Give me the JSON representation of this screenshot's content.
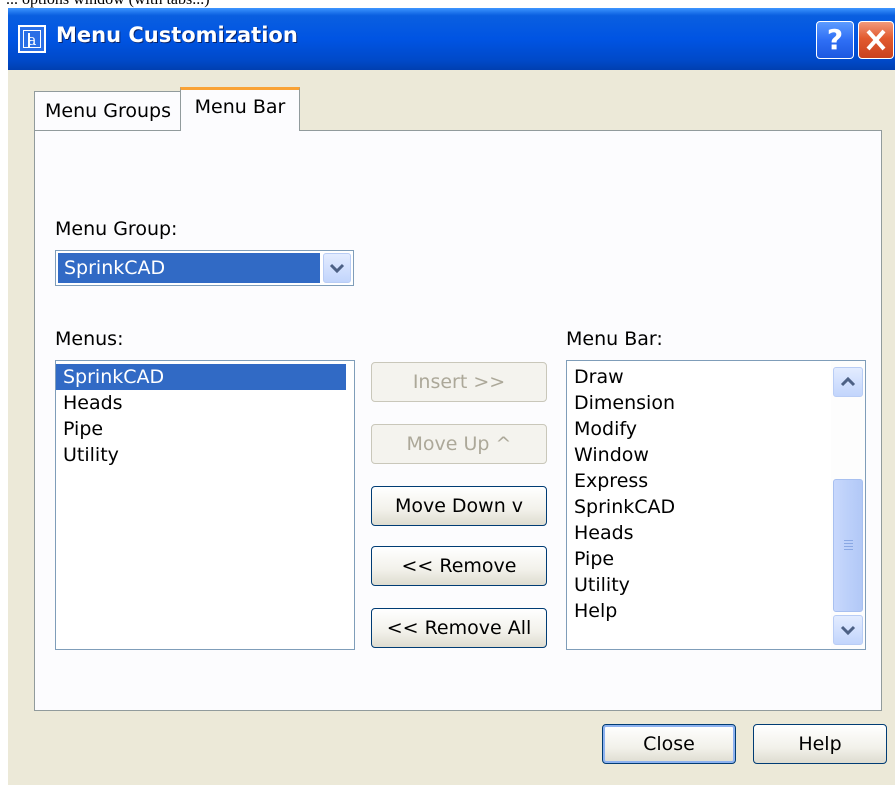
{
  "page_strip_text": "... options window (with tabs...)",
  "window": {
    "title": "Menu Customization",
    "help_glyph": "?",
    "close_glyph": "X",
    "icon": "app-icon"
  },
  "tabs": [
    {
      "label": "Menu Groups",
      "active": false
    },
    {
      "label": "Menu Bar",
      "active": true
    }
  ],
  "menu_group": {
    "label": "Menu Group:",
    "value": "SprinkCAD"
  },
  "menus": {
    "label": "Menus:",
    "items": [
      "SprinkCAD",
      "Heads",
      "Pipe",
      "Utility"
    ],
    "selected": "SprinkCAD"
  },
  "menu_bar": {
    "label": "Menu Bar:",
    "items": [
      "Draw",
      "Dimension",
      "Modify",
      "Window",
      "Express",
      "SprinkCAD",
      "Heads",
      "Pipe",
      "Utility",
      "Help"
    ]
  },
  "buttons": {
    "insert": "Insert >>",
    "move_up": "Move Up ^",
    "move_down": "Move Down v",
    "remove": "<< Remove",
    "remove_all": "<< Remove All",
    "close": "Close",
    "help": "Help"
  },
  "colors": {
    "titlebar": "#0054e3",
    "selection": "#316ac5",
    "active_tab_accent": "#f9a236",
    "dialog_face": "#ece9d8"
  }
}
